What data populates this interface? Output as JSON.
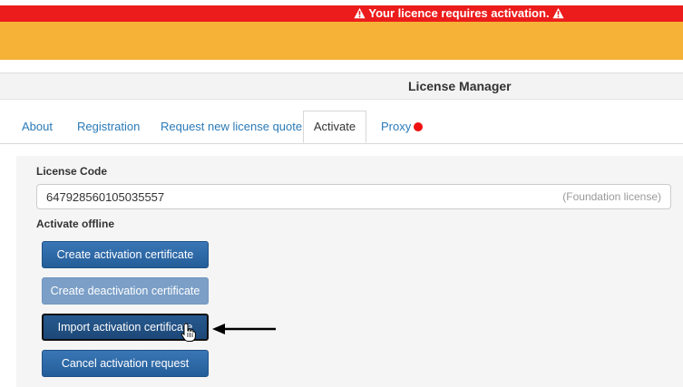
{
  "alert": {
    "message": "Your licence requires activation."
  },
  "header": {
    "title": "License Manager"
  },
  "tabs": [
    {
      "label": "About",
      "active": false
    },
    {
      "label": "Registration",
      "active": false
    },
    {
      "label": "Request new license quote",
      "active": false
    },
    {
      "label": "Activate",
      "active": true
    },
    {
      "label": "Proxy",
      "active": false,
      "status": "red-dot"
    }
  ],
  "license": {
    "code_label": "License Code",
    "code_value": "647928560105035557",
    "code_type": "(Foundation license)"
  },
  "offline": {
    "section_label": "Activate offline",
    "buttons": {
      "create_activation": "Create activation certificate",
      "create_deactivation": "Create deactivation certificate",
      "import_activation": "Import activation certificate",
      "cancel_request": "Cancel activation request"
    }
  },
  "colors": {
    "alert_red": "#ec1c1c",
    "banner_orange": "#f5b237",
    "tab_link": "#2a7ab8",
    "button_blue": "#2b67a6",
    "button_disabled": "#7b9fc7",
    "status_dot": "#ee1111"
  }
}
